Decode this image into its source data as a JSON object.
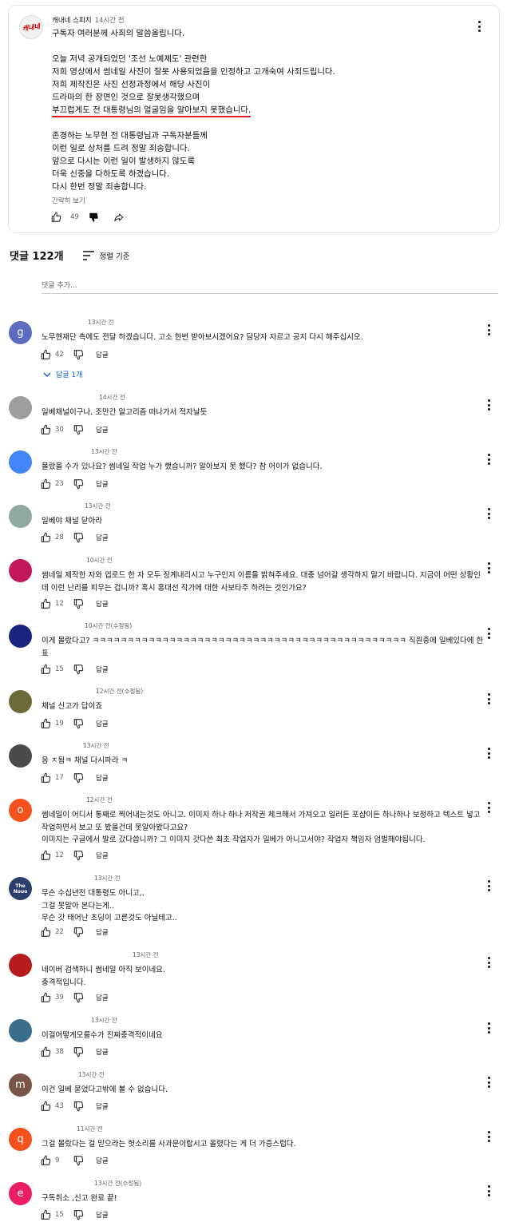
{
  "post": {
    "channel_name": "캐내네 스피치",
    "avatar_text": "캐내네",
    "time": "14시간 전",
    "body": "구독자 여러분께 사죄의 말씀올립니다.\n\n오늘 저녁 공개되었던 '조선 노예제도' 관련한\n저희 영상에서 썸네일 사진이 잘못 사용되었음을 인정하고 고개숙여 사죄드립니다.\n저희 제작진은 사진 선정과정에서 해당 사진이\n드라마의 한 장면인 것으로 잘못생각했으며",
    "highlight": "부끄럽게도 전 대통령님의 얼굴임을 알아보지 못했습니다.",
    "body2": "존경하는 노무현 전 대통령님과 구독자분들께\n이런 일로 상처를 드려 정말 죄송합니다.\n앞으로 다시는 이런 일이 발생하지 않도록\n더욱 신중을 다하도록 하겠습니다.\n다시 한번 정말 죄송합니다.",
    "show_less": "간략히 보기",
    "likes": "49"
  },
  "comments_header": {
    "count_label": "댓글 122개",
    "sort_label": "정렬 기준"
  },
  "add_comment_placeholder": "댓글 추가...",
  "reply_label": "답글",
  "replies_toggle_label": "답글 1개",
  "comments": [
    {
      "time": "13시간 전",
      "text": "노무현재단 측에도 전달 하겠습니다. 고소 한번 받아보시겠어요? 담당자 자르고 공지 다시 해주십시오.",
      "likes": "42",
      "avatar_letter": "g",
      "avatar_color": "#5c6bc0"
    },
    {
      "time": "14시간 전",
      "text": "일베채널이구나. 조만간 알고리즘 떠나가서 적자날듯",
      "likes": "30",
      "avatar_letter": "",
      "avatar_color": "#9e9e9e"
    },
    {
      "time": "13시간 전",
      "text": "몰랐을 수가 있나요? 썸네일 작업 누가 했습니까? 알아보지 못 했다? 참 어이가 없습니다.",
      "likes": "23",
      "avatar_letter": "",
      "avatar_color": "#4285f4"
    },
    {
      "time": "13시간 전",
      "text": "일베야 채널 닫아라",
      "likes": "28",
      "avatar_letter": "",
      "avatar_color": "#8fa9a0"
    },
    {
      "time": "10시간 전",
      "text": "썸네일 제작한 자와 업로드 한 자 모두 징계내리시고 누구인지 이름을 밝혀주세요. 대충 넘어갈 생각하지 말기 바랍니다. 지금이 어떤 상황인데 이런 난리를 피우는 겁니까? 혹시 홍대선 작가에 대한 사보타주 하려는 것인가요?",
      "likes": "12",
      "avatar_letter": "",
      "avatar_color": "#c2185b"
    },
    {
      "time": "10시간 전(수정됨)",
      "text": "이게 몰랐다고? ㅋㅋㅋㅋㅋㅋㅋㅋㅋㅋㅋㅋㅋㅋㅋㅋㅋㅋㅋㅋㅋㅋㅋㅋㅋㅋㅋㅋㅋㅋㅋㅋㅋㅋㅋㅋㅋㅋㅋㅋㅋㅋㅋㅋㅋ 직원중에 일베있다에 한표",
      "likes": "15",
      "avatar_letter": "",
      "avatar_color": "#1a237e"
    },
    {
      "time": "12시간 전(수정됨)",
      "text": "채널 신고가 답이죠",
      "likes": "19",
      "avatar_letter": "",
      "avatar_color": "#6d6a3a"
    },
    {
      "time": "13시간 전",
      "text": "응 ㅈ됨ㅋ 채널 다시파라 ㅋ",
      "likes": "17",
      "avatar_letter": "",
      "avatar_color": "#4e4a48"
    },
    {
      "time": "12시간 전",
      "text": "썸네일이 어디서 통째로 찍어내는것도 아니고. 이미지 하나 하나 저작권 체크해서 가져오고 일러든 포샵이든 하나하나 보정하고 텍스트 넣고 작업하면서 보고 또 봤을건데 못알아봤다고요?\n이미지는 구글에서 발로 갔다씁니까? 그 이미지 갓다쓴 최초 작업자가 일베가 아니고서야? 작업자 책임자 엄벌해야됩니다.",
      "likes": "12",
      "avatar_letter": "o",
      "avatar_color": "#f4511e"
    },
    {
      "time": "13시간 전",
      "text": "무슨 수십년전 대통령도 아니고,,\n그걸 못알아 본다는게..\n무슨 갓 태어난 초딩이 고른것도 아닐테고..",
      "likes": "22",
      "avatar_letter": "The Nouo",
      "avatar_color": "#2c3e6b"
    },
    {
      "time": "13시간 전",
      "text": "네이버 검색하니 썸네일 아직 보이네요.\n충격적입니다.",
      "likes": "39",
      "avatar_letter": "",
      "avatar_color": "#b71c1c"
    },
    {
      "time": "13시간 전",
      "text": "이걸어떻게모를수가 진짜충격적이네요",
      "likes": "38",
      "avatar_letter": "",
      "avatar_color": "#3b6d8c"
    },
    {
      "time": "13시간 전",
      "text": "이건 일베 묻었다고밖에 볼 수 없습니다.",
      "likes": "43",
      "avatar_letter": "m",
      "avatar_color": "#795548"
    },
    {
      "time": "11시간 전",
      "text": "그걸 몰랐다는 걸 믿으라는 헛소리를 사과문이랍시고 올렸다는 게 더 가증스럽다.",
      "likes": "9",
      "avatar_letter": "q",
      "avatar_color": "#f4511e"
    },
    {
      "time": "13시간 전(수정됨)",
      "text": "구독취소 ,신고 완료 끝!",
      "likes": "15",
      "avatar_letter": "e",
      "avatar_color": "#e91e63"
    }
  ]
}
